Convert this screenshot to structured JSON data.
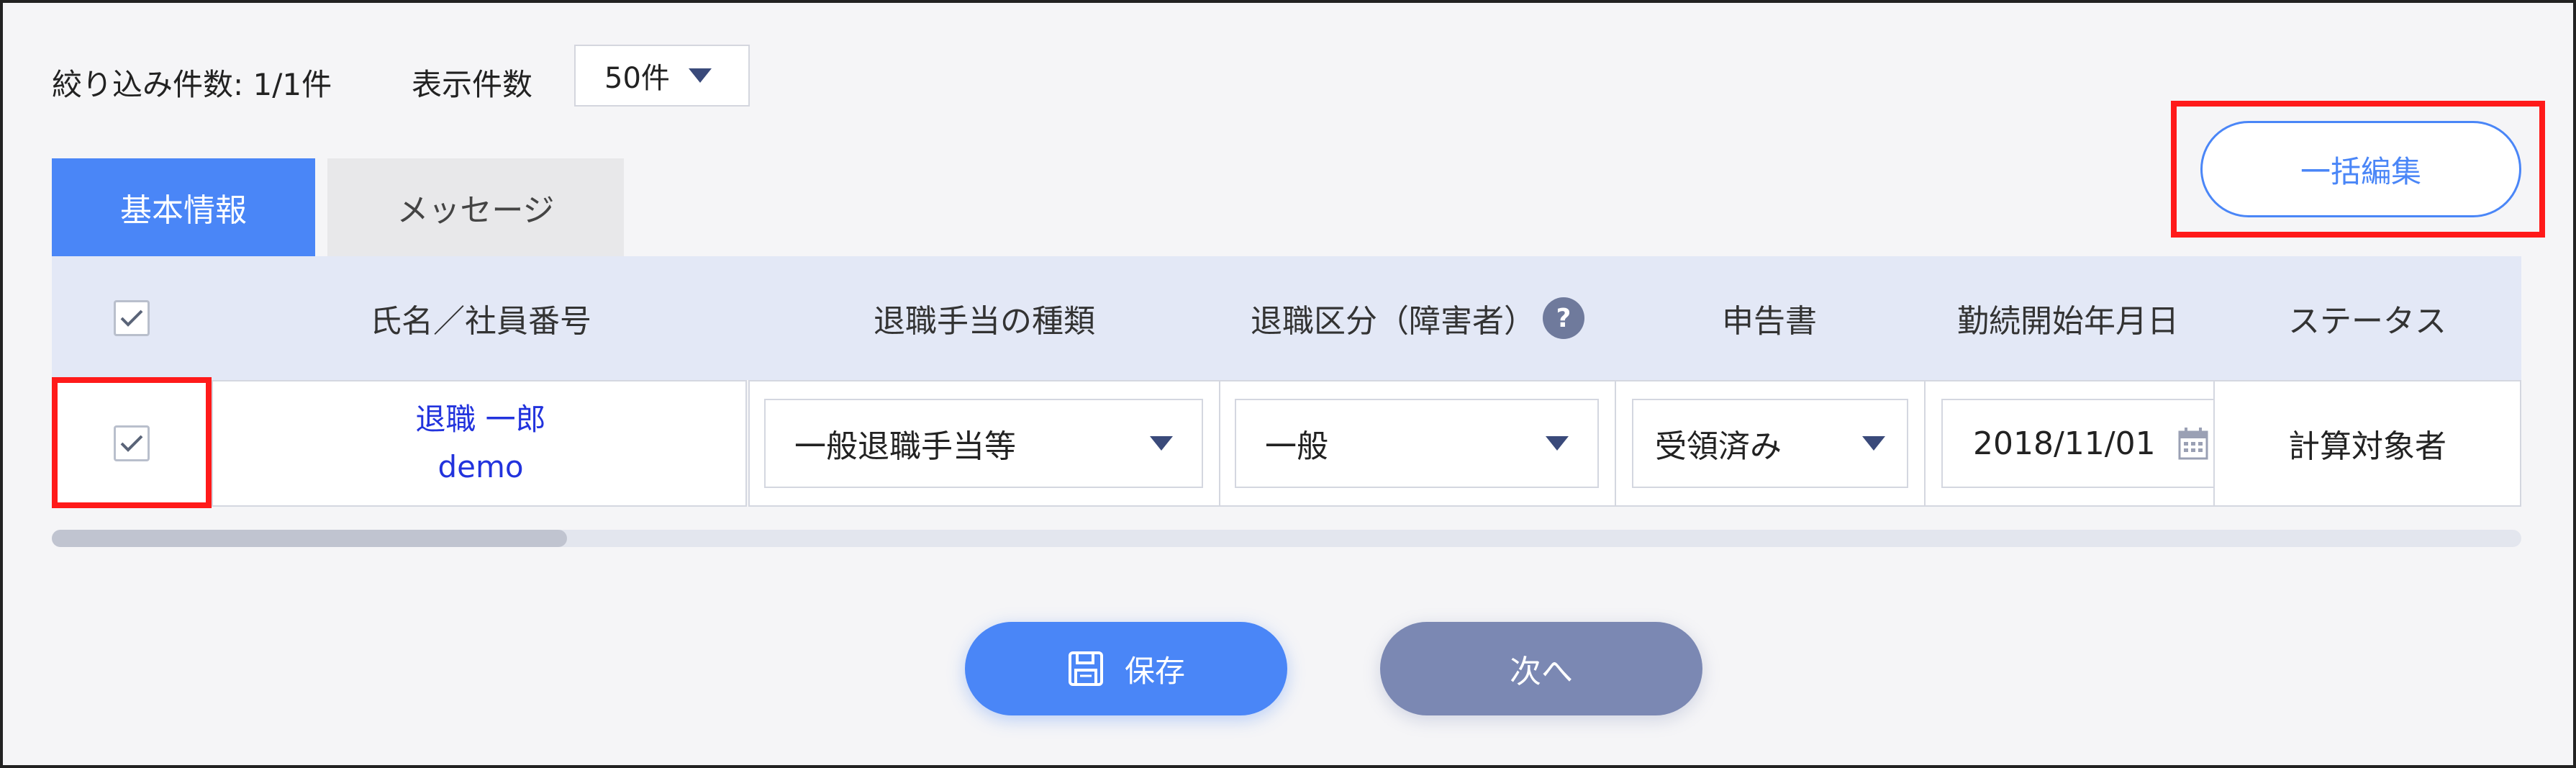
{
  "filter": {
    "count_label": "絞り込み件数: 1/1件"
  },
  "per_page": {
    "label": "表示件数",
    "selected": "50件"
  },
  "tabs": [
    {
      "label": "基本情報",
      "active": true
    },
    {
      "label": "メッセージ",
      "active": false
    }
  ],
  "bulk_edit": {
    "label": "一括編集"
  },
  "table": {
    "headers": {
      "name": "氏名／社員番号",
      "allowance_type": "退職手当の種類",
      "retirement_class": "退職区分（障害者）",
      "declaration": "申告書",
      "start_date": "勤続開始年月日",
      "status": "ステータス"
    },
    "help_icon": "?",
    "rows": [
      {
        "checked": true,
        "name": "退職 一郎",
        "employee_id": "demo",
        "allowance_type": "一般退職手当等",
        "retirement_class": "一般",
        "declaration": "受領済み",
        "start_date": "2018/11/01",
        "status": "計算対象者"
      }
    ]
  },
  "scrollbar": {
    "position": 0
  },
  "actions": {
    "save_label": "保存",
    "next_label": "次へ"
  },
  "colors": {
    "primary": "#4a86f7",
    "secondary": "#7b88b3",
    "header_bg": "#e3e8f6",
    "highlight": "#ff1a1a",
    "link": "#2233dd"
  },
  "icons": {
    "dropdown": "chevron-down-icon",
    "calendar": "calendar-icon",
    "save": "floppy-disk-icon",
    "check": "check-icon",
    "help": "question-icon"
  }
}
